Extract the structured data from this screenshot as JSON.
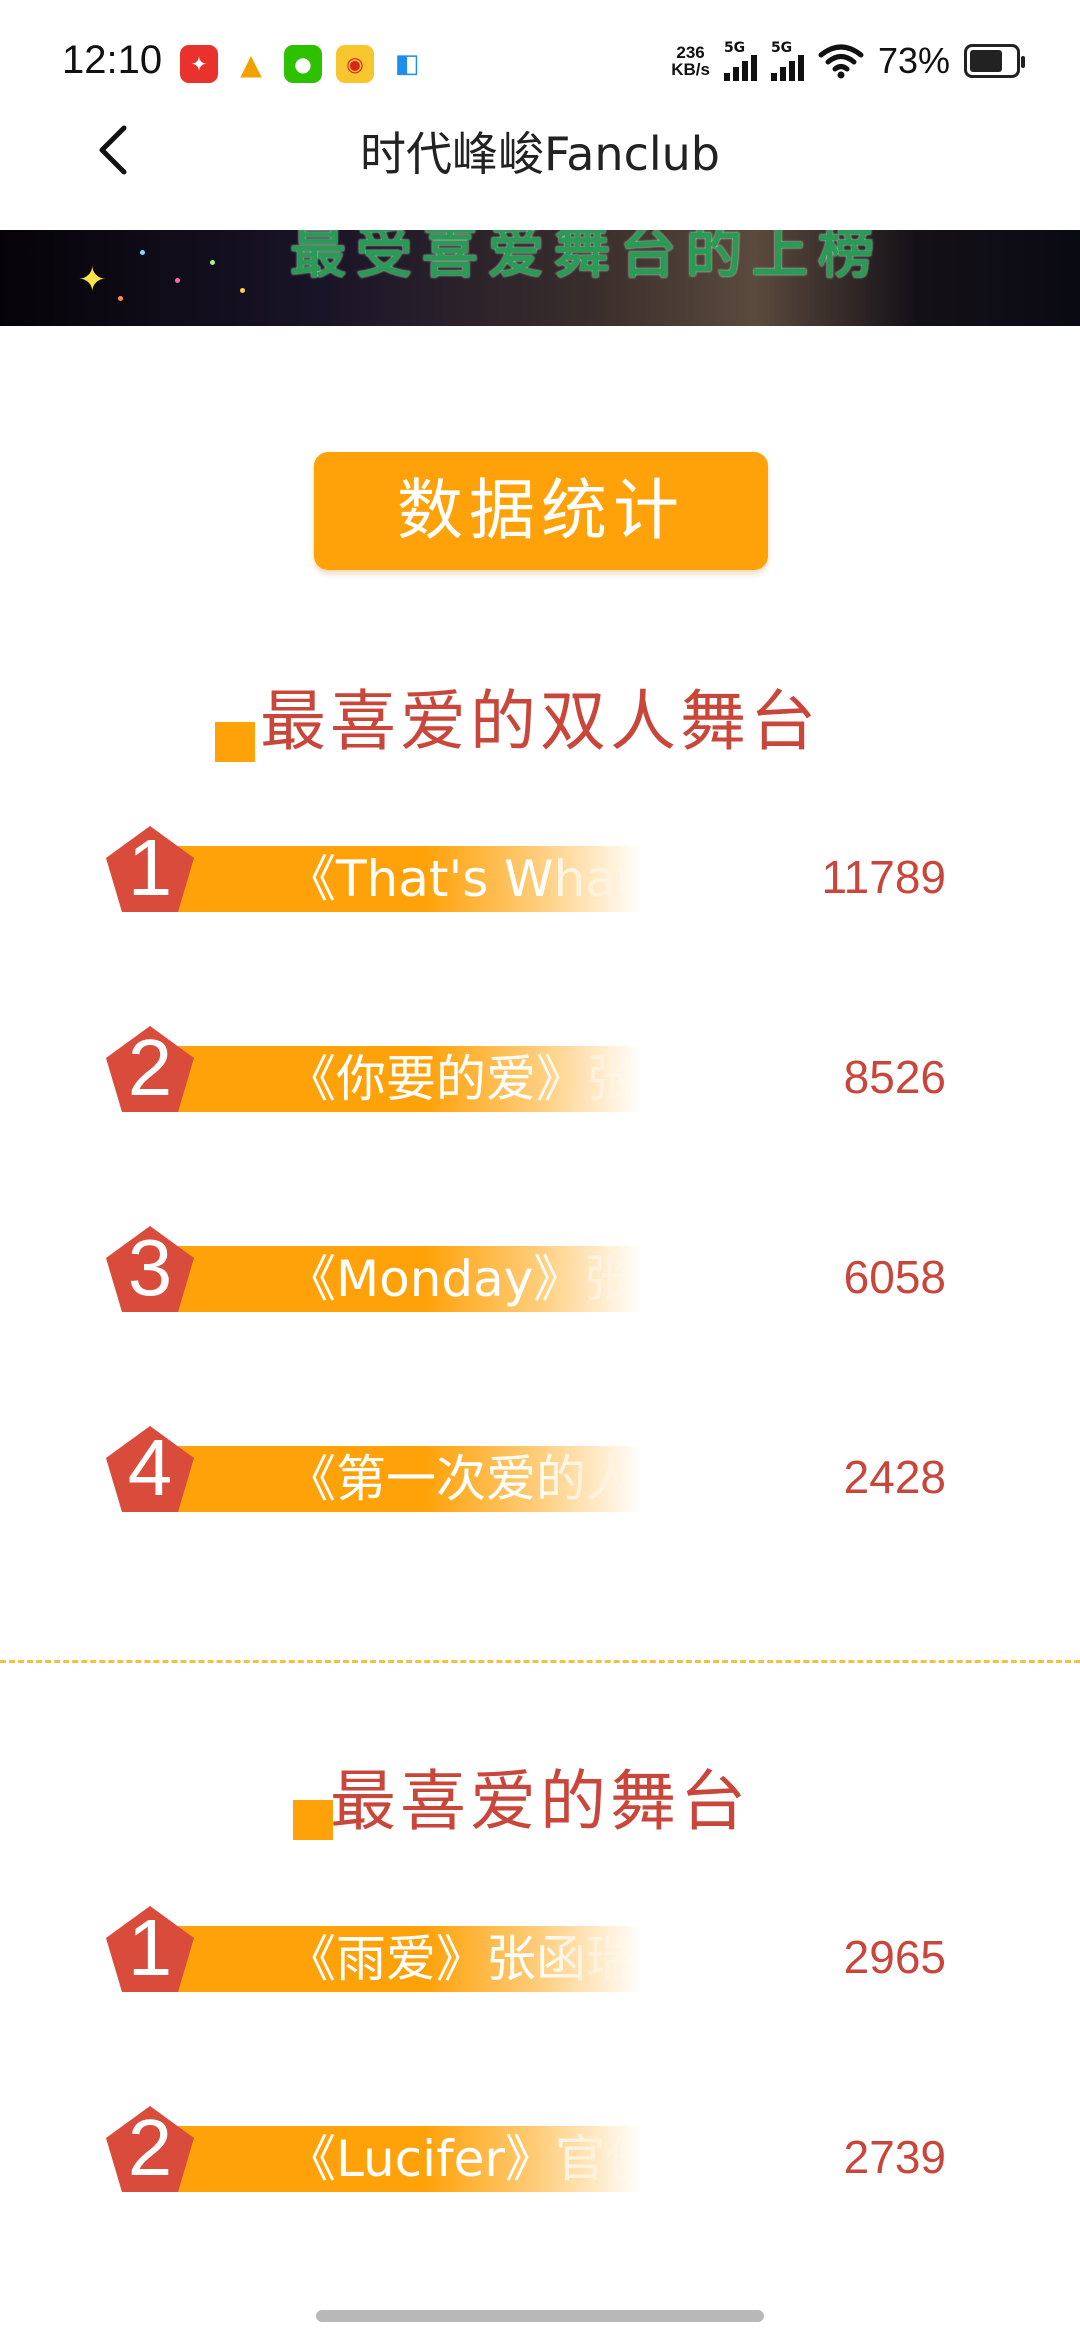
{
  "status_bar": {
    "time": "12:10",
    "net_speed_value": "236",
    "net_speed_unit": "KB/s",
    "signal_1_label": "5G",
    "signal_2_label": "5G",
    "battery": "73%",
    "battery_level": 0.73
  },
  "header": {
    "title": "时代峰峻Fanclub"
  },
  "banner": {
    "text": "最受喜爱舞台的上榜"
  },
  "stats_section": {
    "label": "数据统计"
  },
  "duo_section": {
    "title": "最喜爱的双人舞台",
    "items": [
      {
        "rank": "1",
        "name": "《That's What I Like》",
        "count": "11789"
      },
      {
        "rank": "2",
        "name": "《你要的爱》张函瑞",
        "count": "8526"
      },
      {
        "rank": "3",
        "name": "《Monday》张桂源",
        "count": "6058"
      },
      {
        "rank": "4",
        "name": "《第一次爱的人》",
        "count": "2428"
      }
    ]
  },
  "solo_section": {
    "title": "最喜爱的舞台",
    "items": [
      {
        "rank": "1",
        "name": "《雨爱》张函瑞/",
        "count": "2965"
      },
      {
        "rank": "2",
        "name": "《Lucifer》官俊臣",
        "count": "2739"
      }
    ]
  },
  "colors": {
    "accent_orange": "#ffa20a",
    "rank_red": "#d94b3a",
    "text_red": "#c8463a"
  }
}
